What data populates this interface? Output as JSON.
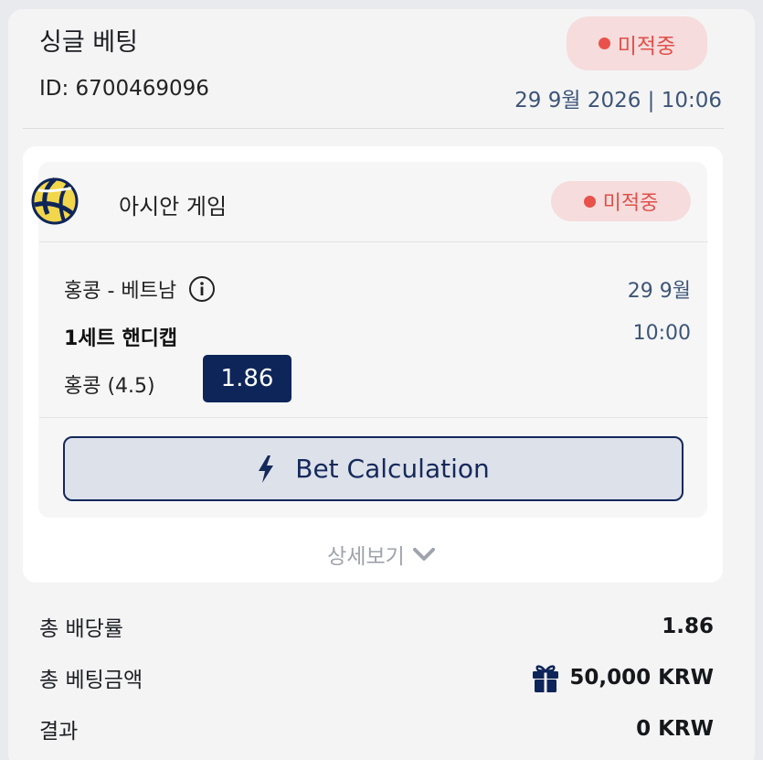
{
  "ticket": {
    "title": "싱글 베팅",
    "id": "ID: 6700469096",
    "datetime": "29 9월 2026 | 10:06",
    "status": "미적중"
  },
  "event": {
    "sport_icon": "volleyball-icon",
    "league": "아시안 게임",
    "status": "미적중",
    "match": "홍콩 - 베트남",
    "date": "29 9월",
    "market": "1세트 핸디캡",
    "time": "10:00",
    "pick": "홍콩 (4.5)",
    "odds": "1.86"
  },
  "actions": {
    "bet_calculation": "Bet Calculation",
    "details": "상세보기"
  },
  "summary": {
    "total_odds_label": "총 배당률",
    "total_odds_value": "1.86",
    "total_stake_label": "총 베팅금액",
    "total_stake_value": "50,000 KRW",
    "result_label": "결과",
    "result_value": "0 KRW"
  },
  "colors": {
    "navy": "#0e2559",
    "lost_red": "#e8524b",
    "lost_bg": "#f6dcdc",
    "date_blue": "#3d5577"
  }
}
